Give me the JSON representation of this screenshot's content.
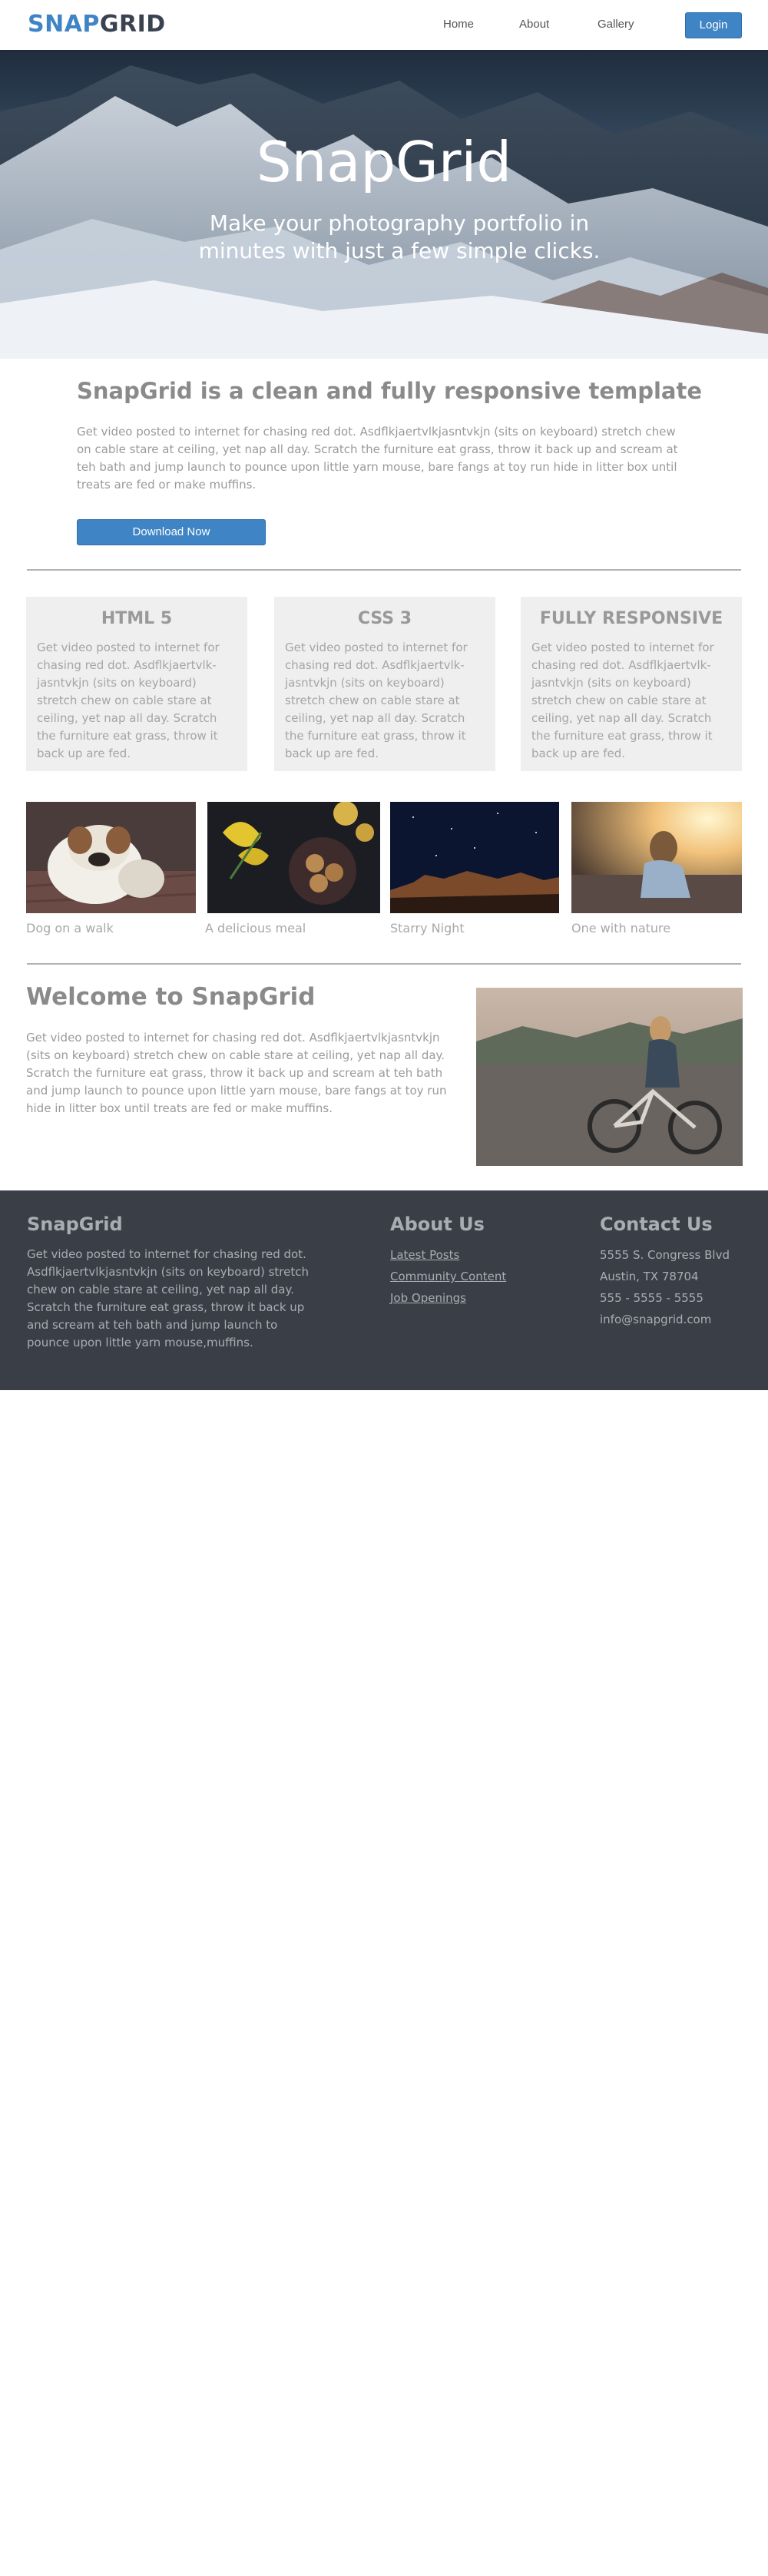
{
  "nav": {
    "logo_part1": "SNAP",
    "logo_part2": "GRID",
    "links": [
      "Home",
      "About",
      "Gallery"
    ],
    "login_label": "Login"
  },
  "hero": {
    "title": "SnapGrid",
    "subtitle": "Make your photography portfolio in minutes with just a few simple clicks."
  },
  "intro": {
    "title": "SnapGrid is a clean and fully responsive template",
    "text": "Get video posted to internet for chasing red dot. Asdflkjaertvlkjasntvkjn (sits on keyboard) stretch chew on cable stare at ceiling, yet nap all day. Scratch the furniture eat grass, throw it back up and scream at teh bath and jump launch to pounce upon little yarn mouse, bare fangs at toy run hide in litter box until treats are fed or make muffins.",
    "button_label": "Download Now"
  },
  "features": [
    {
      "title": "HTML 5",
      "text": "Get video posted to internet for chasing red dot. Asdflkjaertvlk-jasntvkjn (sits on keyboard) stretch chew on cable stare at ceiling, yet nap all day. Scratch the furniture eat grass, throw it back up are fed."
    },
    {
      "title": "CSS 3",
      "text": "Get video posted to internet for chasing red dot. Asdflkjaertvlk-jasntvkjn (sits on keyboard) stretch chew on cable stare at ceiling, yet nap all day. Scratch the furniture eat grass, throw it back up are fed."
    },
    {
      "title": "FULLY RESPONSIVE",
      "text": "Get video posted to internet for chasing red dot. Asdflkjaertvlk-jasntvkjn (sits on keyboard) stretch chew on cable stare at ceiling, yet nap all day. Scratch the furniture eat grass, throw it back up are fed."
    }
  ],
  "gallery": [
    {
      "caption": "Dog on a walk"
    },
    {
      "caption": "A delicious meal"
    },
    {
      "caption": "Starry Night"
    },
    {
      "caption": "One with nature"
    }
  ],
  "welcome": {
    "title": "Welcome to SnapGrid",
    "text": "Get video posted to internet for chasing red dot. Asdflkjaertvlkjasntvkjn (sits on keyboard) stretch chew on cable stare at ceiling, yet nap all day. Scratch the furniture eat grass, throw it back up and scream at teh bath and jump launch to pounce upon little yarn mouse, bare fangs at toy run hide in litter box until treats are fed or make muffins."
  },
  "footer": {
    "brand_title": "SnapGrid",
    "brand_text": "Get video posted to internet for chasing red dot. Asdflkjaertvlkjasntvkjn (sits on keyboard) stretch chew on cable stare at ceiling, yet nap all day. Scratch the furniture eat grass, throw it back up and scream at teh bath and jump launch to pounce upon little yarn mouse,muffins.",
    "about_title": "About Us",
    "about_links": [
      "Latest Posts",
      "Community Content",
      "Job Openings"
    ],
    "contact_title": "Contact Us",
    "contact_lines": [
      "5555 S. Congress Blvd",
      "Austin, TX 78704",
      "555 - 5555 - 5555",
      "info@snapgrid.com"
    ]
  },
  "colors": {
    "accent": "#3f84c4",
    "logo_dark": "#3a4250",
    "footer_bg": "#3a3f47",
    "feature_bg": "#efefef"
  }
}
